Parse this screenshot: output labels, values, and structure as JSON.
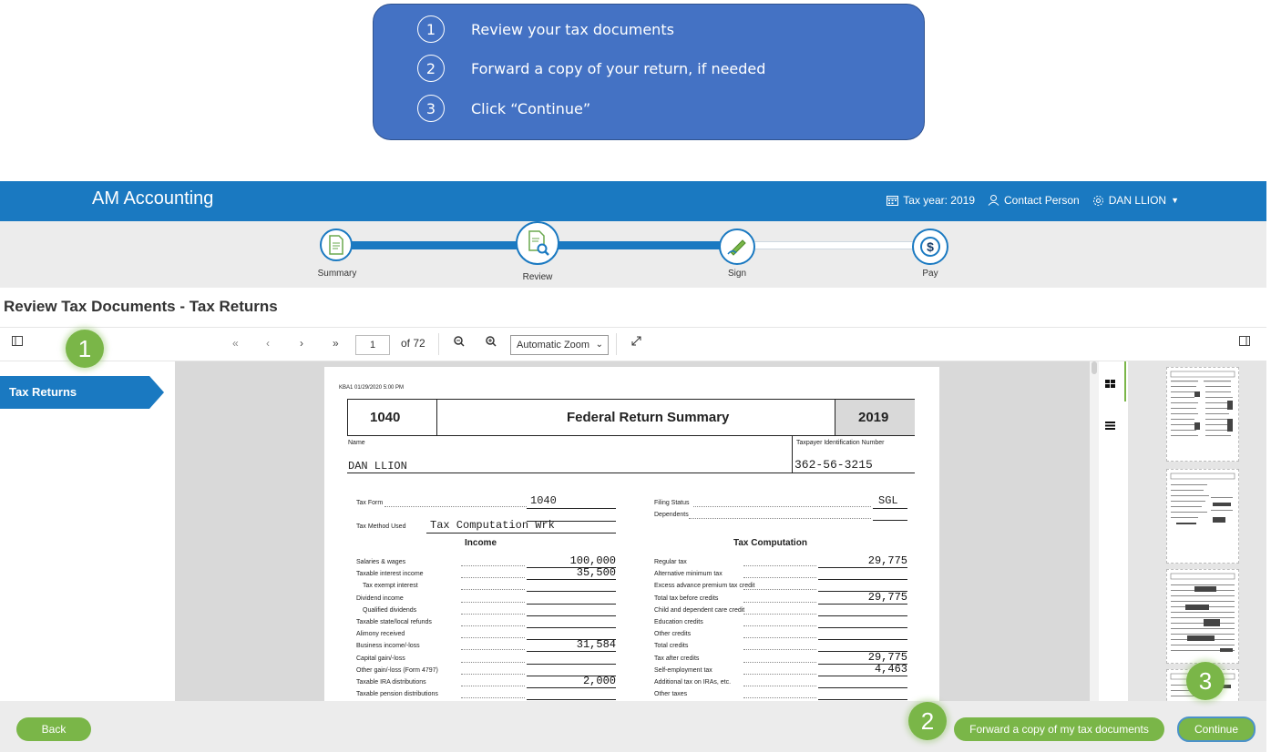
{
  "callout": {
    "steps": [
      {
        "num": "1",
        "text": "Review your tax documents"
      },
      {
        "num": "2",
        "text": "Forward a copy of your return, if needed"
      },
      {
        "num": "3",
        "text": "Click “Continue”"
      }
    ]
  },
  "header": {
    "brand": "AM Accounting",
    "tax_year": "Tax year: 2019",
    "contact": "Contact Person",
    "user": "DAN LLION"
  },
  "progress": {
    "steps": [
      {
        "label": "Summary",
        "icon": "summary-doc-icon"
      },
      {
        "label": "Review",
        "icon": "review-search-icon"
      },
      {
        "label": "Sign",
        "icon": "pen-icon"
      },
      {
        "label": "Pay",
        "icon": "dollar-icon"
      }
    ],
    "current": "Review"
  },
  "page_title": "Review Tax Documents - Tax Returns",
  "toolbar": {
    "page": "1",
    "page_of": "of 72",
    "zoom": "Automatic Zoom"
  },
  "sidebar": {
    "tab": "Tax Returns"
  },
  "document": {
    "timestamp": "KBA1 01/29/2020 5:00 PM",
    "form": "1040",
    "title": "Federal Return Summary",
    "year": "2019",
    "name_label": "Name",
    "tin_label": "Taxpayer Identification Number",
    "name": "DAN LLION",
    "tin": "362-56-3215",
    "tax_form_label": "Tax Form",
    "tax_form": "1040",
    "tax_method_label": "Tax Method Used",
    "tax_method": "Tax Computation Wrk",
    "filing_status_label": "Filing Status",
    "filing_status": "SGL",
    "dependents_label": "Dependents",
    "income_heading": "Income",
    "taxcomp_heading": "Tax Computation",
    "income": [
      {
        "label": "Salaries & wages",
        "value": "100,000"
      },
      {
        "label": "Taxable interest income",
        "value": "35,500"
      },
      {
        "label": "Tax exempt interest",
        "value": ""
      },
      {
        "label": "Dividend income",
        "value": ""
      },
      {
        "label": "Qualified dividends",
        "value": ""
      },
      {
        "label": "Taxable state/local refunds",
        "value": ""
      },
      {
        "label": "Alimony received",
        "value": ""
      },
      {
        "label": "Business income/-loss",
        "value": "31,584"
      },
      {
        "label": "Capital gain/-loss",
        "value": ""
      },
      {
        "label": "Other gain/-loss (Form 4797)",
        "value": ""
      },
      {
        "label": "Taxable IRA distributions",
        "value": "2,000"
      },
      {
        "label": "Taxable pension distributions",
        "value": ""
      }
    ],
    "taxcomp": [
      {
        "label": "Regular tax",
        "value": "29,775"
      },
      {
        "label": "Alternative minimum tax",
        "value": ""
      },
      {
        "label": "Excess advance premium tax credit",
        "value": ""
      },
      {
        "label": "Total tax before credits",
        "value": "29,775"
      },
      {
        "label": "Child and dependent care credit",
        "value": ""
      },
      {
        "label": "Education credits",
        "value": ""
      },
      {
        "label": "Other credits",
        "value": ""
      },
      {
        "label": "Total credits",
        "value": ""
      },
      {
        "label": "Tax after credits",
        "value": "29,775"
      },
      {
        "label": "Self-employment tax",
        "value": "4,463"
      },
      {
        "label": "Additional tax on IRAs, etc.",
        "value": ""
      },
      {
        "label": "Other taxes",
        "value": ""
      }
    ]
  },
  "footer": {
    "back": "Back",
    "forward": "Forward a copy of my tax documents",
    "continue": "Continue"
  },
  "bubbles": {
    "one": "1",
    "two": "2",
    "three": "3"
  },
  "colors": {
    "brand_blue": "#1a79c1",
    "callout_blue": "#4472c4",
    "green": "#7ab648"
  }
}
